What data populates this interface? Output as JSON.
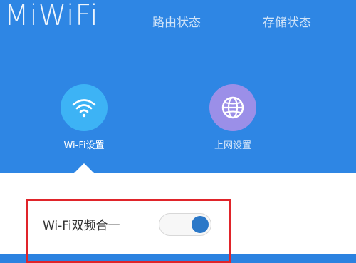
{
  "header": {
    "logo_text": "MiWiFi",
    "nav": [
      {
        "label": "路由状态"
      },
      {
        "label": "存储状态"
      }
    ]
  },
  "tiles": [
    {
      "label": "Wi-Fi设置",
      "icon": "wifi-icon",
      "color": "#3db3f5",
      "selected": true
    },
    {
      "label": "上网设置",
      "icon": "globe-icon",
      "color": "#9b8fe8",
      "selected": false
    }
  ],
  "settings": {
    "dual_band": {
      "label": "Wi-Fi双频合一",
      "enabled": true
    }
  },
  "colors": {
    "header_bg": "#2e86e4",
    "highlight_border": "#e0242a",
    "toggle_knob": "#2b78c8"
  }
}
